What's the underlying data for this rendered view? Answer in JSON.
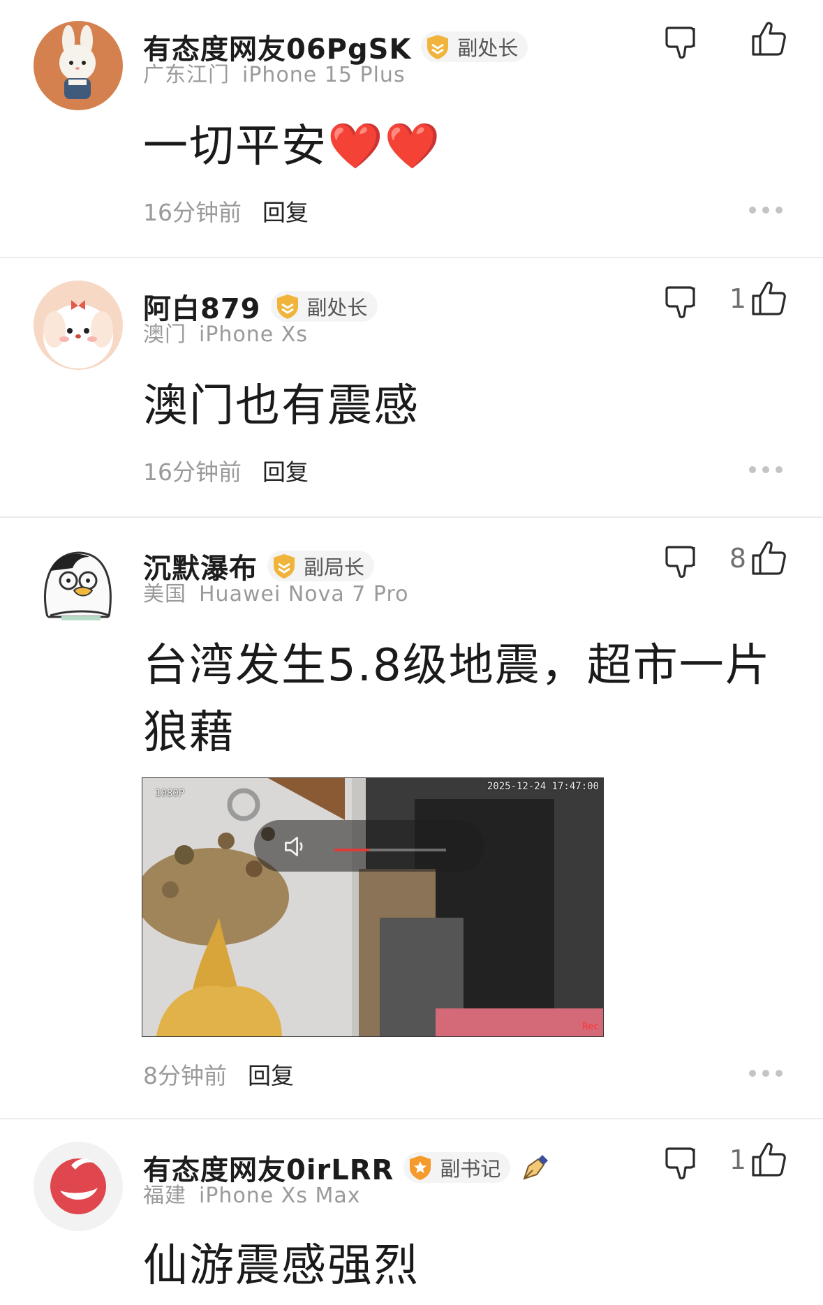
{
  "colors": {
    "badge_gold": "#f0b43c",
    "badge_orange": "#f59a2c",
    "muted": "#9a9a9a",
    "divider": "#ececec"
  },
  "comments": [
    {
      "username": "有态度网友06PgSK",
      "rank": "副处长",
      "rank_icon": "shield-badge-icon",
      "location": "广东江门",
      "device": "iPhone 15 Plus",
      "text": "一切平安❤️❤️",
      "time": "16分钟前",
      "reply_label": "回复",
      "like_count": ""
    },
    {
      "username": "阿白879",
      "rank": "副处长",
      "rank_icon": "shield-badge-icon",
      "location": "澳门",
      "device": "iPhone Xs",
      "text": "澳门也有震感",
      "time": "16分钟前",
      "reply_label": "回复",
      "like_count": "1"
    },
    {
      "username": "沉默瀑布",
      "rank": "副局长",
      "rank_icon": "shield-badge-icon",
      "location": "美国",
      "device": "Huawei Nova 7 Pro",
      "text": "台湾发生5.8级地震，超市一片狼藉",
      "time": "8分钟前",
      "reply_label": "回复",
      "like_count": "8",
      "video": {
        "resolution": "1080P",
        "timestamp": "2025-12-24 17:47:00",
        "rec_label": "Rec",
        "icon": "volume-icon"
      }
    },
    {
      "username": "有态度网友0irLRR",
      "rank": "副书记",
      "rank_icon": "star-badge-icon",
      "extra_icon": "fountain-pen-icon",
      "location": "福建",
      "device": "iPhone Xs Max",
      "text": "仙游震感强烈",
      "like_count": "1"
    }
  ]
}
